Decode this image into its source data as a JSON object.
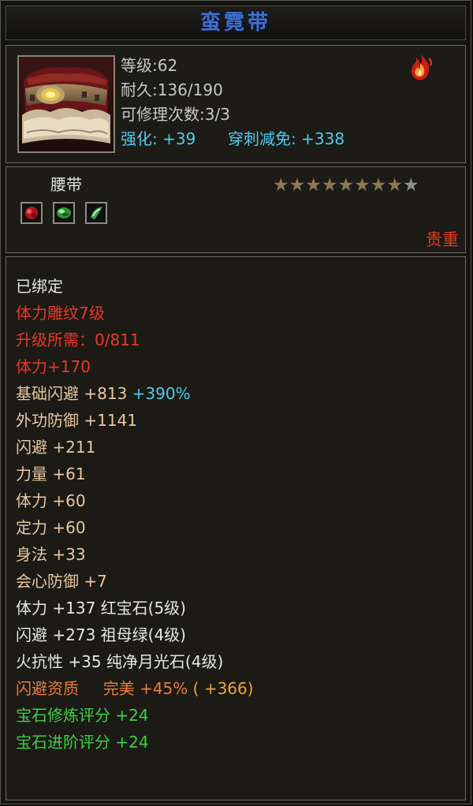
{
  "item": {
    "name": "蛮霓带",
    "type": "腰带",
    "rarity": "贵重",
    "stats": {
      "level": "等级:62",
      "durability": "耐久:136/190",
      "repairs": "可修理次数:3/3",
      "enhance_label": "强化:",
      "enhance_value": "+39",
      "pierce_label": "穿刺减免:",
      "pierce_value": "+338"
    },
    "stars_total": 9,
    "stars_filled": 8,
    "gems": [
      "red-gem-icon",
      "green-gem-icon",
      "moonstone-gem-icon"
    ],
    "colors": {
      "title": "#3f6ed0",
      "red": "#e8392a",
      "cyan": "#4fcbf0",
      "green": "#3fcf44",
      "orange": "#e97e3f",
      "tan": "#e8c9a0"
    }
  },
  "attributes": {
    "bound": "已绑定",
    "engrave": "体力雕纹7级",
    "upgrade_need": "升级所需：0/811",
    "vit_engrave": "体力+170",
    "base_dodge": "基础闪避 +813",
    "base_dodge_pct": "+390%",
    "ext_def": "外功防御 +1141",
    "dodge": "闪避 +211",
    "strength": "力量 +61",
    "vitality": "体力 +60",
    "focus": "定力 +60",
    "agility": "身法 +33",
    "crit_def": "会心防御 +7",
    "gem1": "体力 +137 红宝石(5级)",
    "gem2": "闪避 +273 祖母绿(4级)",
    "gem3": "火抗性 +35 纯净月光石(4级)",
    "quality_label": "闪避资质",
    "quality_value": "完美",
    "quality_bonus": "+45%",
    "quality_extra": "( +366)",
    "gem_refine": "宝石修炼评分 +24",
    "gem_advance": "宝石进阶评分 +24"
  }
}
